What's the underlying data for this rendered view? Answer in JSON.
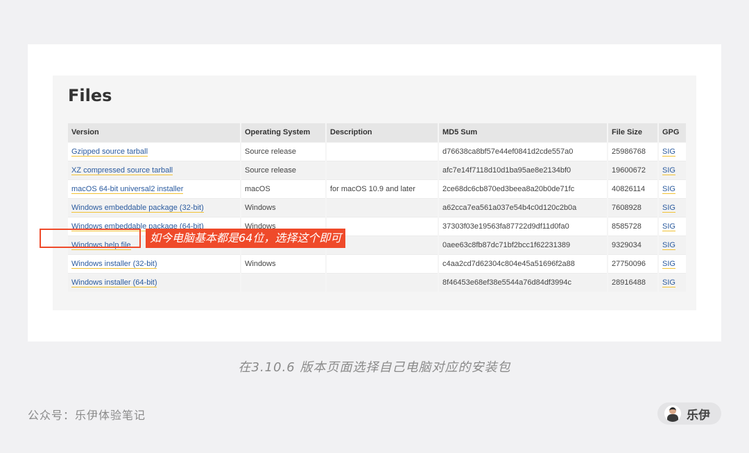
{
  "files": {
    "title": "Files",
    "columns": [
      "Version",
      "Operating System",
      "Description",
      "MD5 Sum",
      "File Size",
      "GPG"
    ],
    "rows": [
      {
        "version": "Gzipped source tarball",
        "os": "Source release",
        "description": "",
        "md5": "d76638ca8bf57e44ef0841d2cde557a0",
        "size": "25986768",
        "gpg": "SIG"
      },
      {
        "version": "XZ compressed source tarball",
        "os": "Source release",
        "description": "",
        "md5": "afc7e14f7118d10d1ba95ae8e2134bf0",
        "size": "19600672",
        "gpg": "SIG"
      },
      {
        "version": "macOS 64-bit universal2 installer",
        "os": "macOS",
        "description": "for macOS 10.9 and later",
        "md5": "2ce68dc6cb870ed3beea8a20b0de71fc",
        "size": "40826114",
        "gpg": "SIG"
      },
      {
        "version": "Windows embeddable package (32-bit)",
        "os": "Windows",
        "description": "",
        "md5": "a62cca7ea561a037e54b4c0d120c2b0a",
        "size": "7608928",
        "gpg": "SIG"
      },
      {
        "version": "Windows embeddable package (64-bit)",
        "os": "Windows",
        "description": "",
        "md5": "37303f03e19563fa87722d9df11d0fa0",
        "size": "8585728",
        "gpg": "SIG"
      },
      {
        "version": "Windows help file",
        "os": "Windows",
        "description": "",
        "md5": "0aee63c8fb87dc71bf2bcc1f62231389",
        "size": "9329034",
        "gpg": "SIG"
      },
      {
        "version": "Windows installer (32-bit)",
        "os": "Windows",
        "description": "",
        "md5": "c4aa2cd7d62304c804e45a51696f2a88",
        "size": "27750096",
        "gpg": "SIG"
      },
      {
        "version": "Windows installer (64-bit)",
        "os": "",
        "description": "",
        "md5": "8f46453e68ef38e5544a76d84df3994c",
        "size": "28916488",
        "gpg": "SIG"
      }
    ]
  },
  "annotation": {
    "callout": "如今电脑基本都是64位，选择这个即可",
    "color": "#ef4a2a"
  },
  "caption": "在3.10.6 版本页面选择自己电脑对应的安装包",
  "footer": {
    "account": "公众号：乐伊体验笔记",
    "author": "乐伊"
  },
  "colors": {
    "link": "#2b5b9f",
    "link_underline": "#f2c233",
    "page_bg": "#f1f1f3"
  }
}
